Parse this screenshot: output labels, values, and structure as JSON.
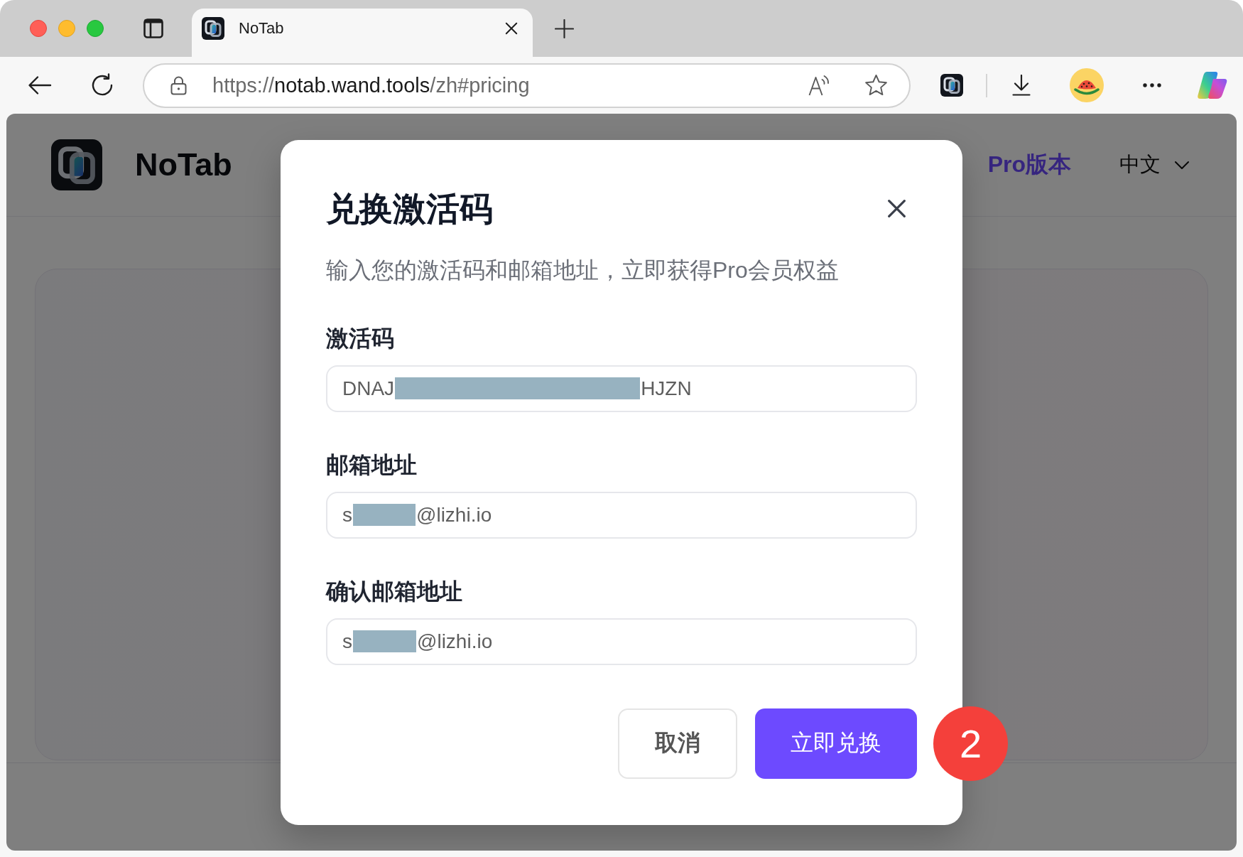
{
  "browser": {
    "tabs": [
      {
        "title": "NoTab",
        "selected": true
      }
    ],
    "url": {
      "scheme": "https://",
      "host": "notab.wand.tools",
      "path": "/zh#pricing"
    }
  },
  "site_header": {
    "logo_text": "NoTab",
    "pro_link": "Pro版本",
    "language": "中文"
  },
  "dialog": {
    "title": "兑换激活码",
    "description": "输入您的激活码和邮箱地址，立即获得Pro会员权益",
    "fields": [
      {
        "label": "激活码",
        "value_parts": [
          {
            "kind": "text",
            "text": "DNAJ"
          },
          {
            "kind": "redaction"
          },
          {
            "kind": "text",
            "text": "HJZN"
          }
        ]
      },
      {
        "label": "邮箱地址",
        "value_parts": [
          {
            "kind": "text",
            "text": "s"
          },
          {
            "kind": "redaction"
          },
          {
            "kind": "text",
            "text": "@lizhi.io"
          }
        ]
      },
      {
        "label": "确认邮箱地址",
        "value_parts": [
          {
            "kind": "text",
            "text": "s"
          },
          {
            "kind": "redaction"
          },
          {
            "kind": "text",
            "text": "@lizhi.io"
          }
        ]
      }
    ],
    "buttons": [
      {
        "label": "取消",
        "kind": "secondary"
      },
      {
        "label": "立即兑换",
        "kind": "primary"
      }
    ]
  },
  "step_badge": "2"
}
